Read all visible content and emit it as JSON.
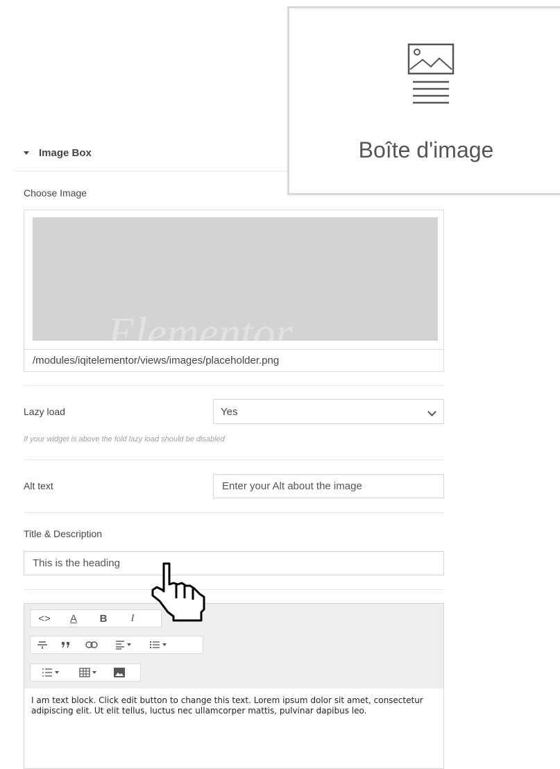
{
  "widget": {
    "label": "Boîte d'image",
    "icon": "image-box-icon"
  },
  "panel": {
    "section_title": "Image Box",
    "choose_image_label": "Choose Image",
    "image_path": "/modules/iqitelementor/views/images/placeholder.png",
    "watermark": "Elementor",
    "lazy_load": {
      "label": "Lazy load",
      "value": "Yes",
      "hint": "If your widget is above the fold lazy load should be disabled"
    },
    "alt_text": {
      "label": "Alt text",
      "placeholder": "Enter your Alt about the image"
    },
    "title_description": {
      "label": "Title & Description",
      "heading_value": "This is the heading"
    },
    "editor": {
      "toolbar_row1": [
        "<>",
        "A",
        "B",
        "I"
      ],
      "body_text": "I am text block. Click edit button to change this text. Lorem ipsum dolor sit amet, consectetur adipiscing elit. Ut elit tellus, luctus nec ullamcorper mattis, pulvinar dapibus leo."
    }
  },
  "colors": {
    "preview_gray": "#d3d3d3",
    "toolbar_bg": "#eceeef",
    "border": "#d5d5d5"
  }
}
